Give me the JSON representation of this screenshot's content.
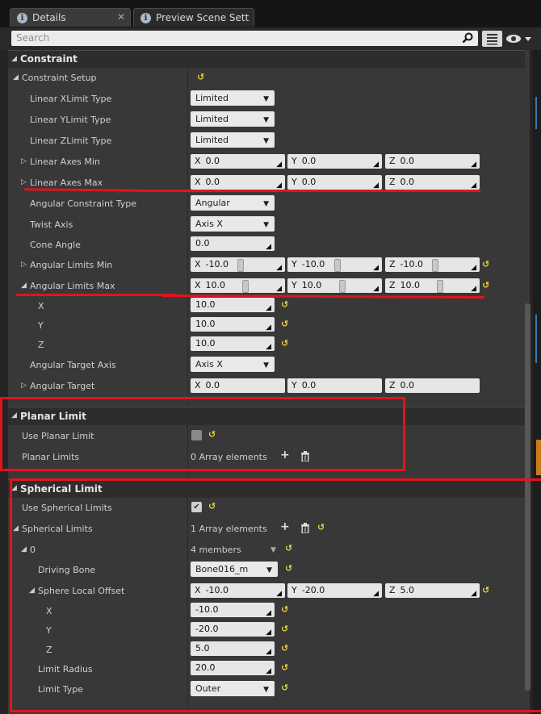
{
  "tabs": [
    {
      "label": "Details",
      "active": true,
      "icon": "info-icon"
    },
    {
      "label": "Preview Scene Sett",
      "active": false,
      "icon": "info-icon"
    }
  ],
  "search": {
    "placeholder": "Search"
  },
  "categories": {
    "constraint": "Constraint",
    "planar": "Planar Limit",
    "spherical": "Spherical Limit"
  },
  "rows": {
    "constraint_setup": "Constraint Setup",
    "linear_x_type": {
      "label": "Linear XLimit Type",
      "value": "Limited"
    },
    "linear_y_type": {
      "label": "Linear YLimit Type",
      "value": "Limited"
    },
    "linear_z_type": {
      "label": "Linear ZLimit Type",
      "value": "Limited"
    },
    "linear_axes_min": {
      "label": "Linear Axes Min",
      "x": "0.0",
      "y": "0.0",
      "z": "0.0"
    },
    "linear_axes_max": {
      "label": "Linear Axes Max",
      "x": "0.0",
      "y": "0.0",
      "z": "0.0"
    },
    "angular_constraint_type": {
      "label": "Angular Constraint Type",
      "value": "Angular"
    },
    "twist_axis": {
      "label": "Twist Axis",
      "value": "Axis X"
    },
    "cone_angle": {
      "label": "Cone Angle",
      "value": "0.0"
    },
    "angular_limits_min": {
      "label": "Angular Limits Min",
      "x": "-10.0",
      "y": "-10.0",
      "z": "-10.0"
    },
    "angular_limits_max": {
      "label": "Angular Limits Max",
      "x": "10.0",
      "y": "10.0",
      "z": "10.0"
    },
    "alm_x": {
      "label": "X",
      "value": "10.0"
    },
    "alm_y": {
      "label": "Y",
      "value": "10.0"
    },
    "alm_z": {
      "label": "Z",
      "value": "10.0"
    },
    "angular_target_axis": {
      "label": "Angular Target Axis",
      "value": "Axis X"
    },
    "angular_target": {
      "label": "Angular Target",
      "x": "0.0",
      "y": "0.0",
      "z": "0.0"
    },
    "use_planar_limit": {
      "label": "Use Planar Limit",
      "checked": false
    },
    "planar_limits": {
      "label": "Planar Limits",
      "value": "0 Array elements"
    },
    "use_spherical_limits": {
      "label": "Use Spherical Limits",
      "checked": true
    },
    "spherical_limits": {
      "label": "Spherical Limits",
      "value": "1 Array elements"
    },
    "element_0": {
      "label": "0",
      "value": "4 members"
    },
    "driving_bone": {
      "label": "Driving Bone",
      "value": "Bone016_m"
    },
    "sphere_local_offset": {
      "label": "Sphere Local Offset",
      "x": "-10.0",
      "y": "-20.0",
      "z": "5.0"
    },
    "slo_x": {
      "label": "X",
      "value": "-10.0"
    },
    "slo_y": {
      "label": "Y",
      "value": "-20.0"
    },
    "slo_z": {
      "label": "Z",
      "value": "5.0"
    },
    "limit_radius": {
      "label": "Limit Radius",
      "value": "20.0"
    },
    "limit_type": {
      "label": "Limit Type",
      "value": "Outer"
    }
  },
  "axis_labels": {
    "x": "X",
    "y": "Y",
    "z": "Z"
  },
  "colors": {
    "annotation": "#e0141c",
    "reset_arrow": "#ead43a"
  }
}
